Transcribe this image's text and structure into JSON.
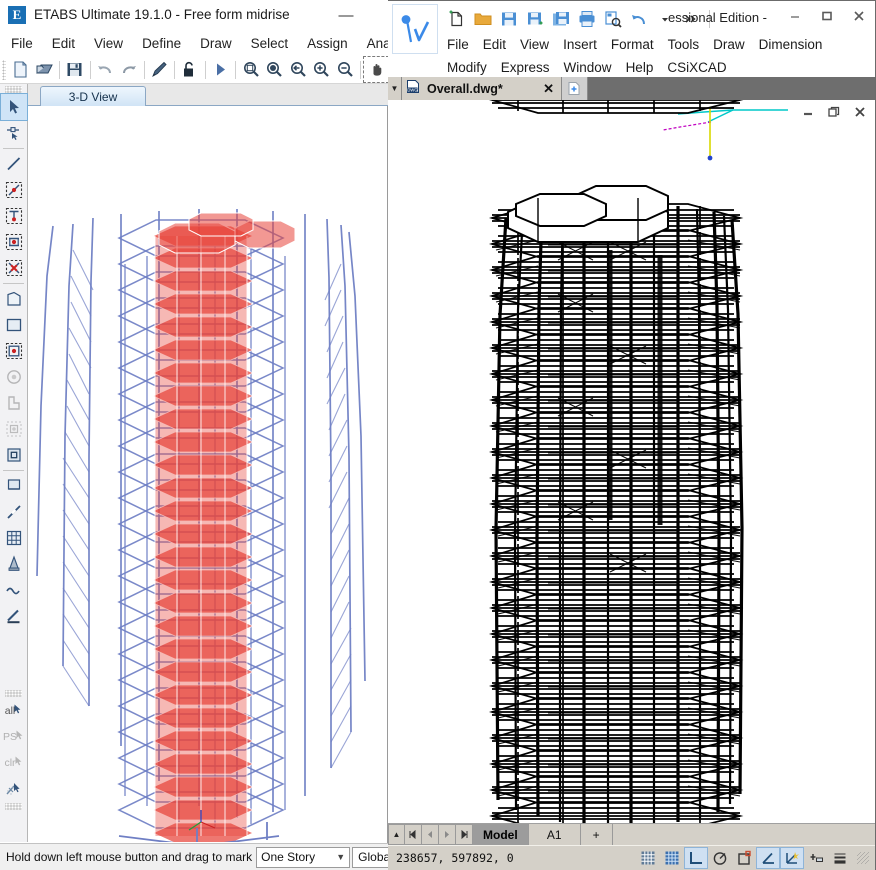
{
  "etabs": {
    "title": "ETABS Ultimate 19.1.0 - Free form midrise",
    "logo_letter": "E",
    "minimize_glyph": "—",
    "menus": [
      "File",
      "Edit",
      "View",
      "Define",
      "Draw",
      "Select",
      "Assign",
      "Analyze"
    ],
    "toolbar": [
      {
        "name": "new-model-icon",
        "tip": "New Model"
      },
      {
        "name": "open-model-icon",
        "tip": "Open Model"
      },
      {
        "name": "save-icon",
        "tip": "Save"
      },
      {
        "name": "undo-icon",
        "tip": "Undo"
      },
      {
        "name": "redo-icon",
        "tip": "Redo"
      },
      {
        "name": "edit-pen-icon",
        "tip": "Modify"
      },
      {
        "name": "unlock-icon",
        "tip": "Lock/Unlock Model"
      },
      {
        "name": "run-analysis-icon",
        "tip": "Run Analysis"
      },
      {
        "name": "zoom-window-icon",
        "tip": "Rubber Band Zoom"
      },
      {
        "name": "zoom-full-icon",
        "tip": "Restore Full View"
      },
      {
        "name": "zoom-previous-icon",
        "tip": "Previous Zoom"
      },
      {
        "name": "zoom-in-icon",
        "tip": "Zoom In One Step"
      },
      {
        "name": "zoom-out-icon",
        "tip": "Zoom Out One Step"
      },
      {
        "name": "pan-icon",
        "tip": "Pan"
      }
    ],
    "side_tools": [
      {
        "name": "select-arrow-icon",
        "selected": true
      },
      {
        "name": "select-poke-icon",
        "selected": false
      },
      {
        "name": "draw-line-icon",
        "selected": false
      },
      {
        "name": "select-line-objects-icon",
        "selected": false
      },
      {
        "name": "select-point-on-line-icon",
        "selected": false
      },
      {
        "name": "select-in-window-icon",
        "selected": false
      },
      {
        "name": "deselect-all-icon",
        "selected": false
      },
      {
        "name": "draw-quad-area-icon",
        "selected": false
      },
      {
        "name": "draw-rect-area-icon",
        "selected": false
      },
      {
        "name": "select-area-objects-icon",
        "selected": false
      },
      {
        "name": "select-circle-icon",
        "selected": false,
        "disabled": true
      },
      {
        "name": "select-wall-icon",
        "selected": false,
        "disabled": true
      },
      {
        "name": "select-floor-icon",
        "selected": false,
        "disabled": true
      },
      {
        "name": "select-frame-section-icon",
        "selected": false
      },
      {
        "name": "draw-developed-elevation-icon",
        "selected": false
      },
      {
        "name": "draw-diagonal-icon",
        "selected": false
      },
      {
        "name": "grid-icon",
        "selected": false
      },
      {
        "name": "set-view-icon",
        "selected": false
      },
      {
        "name": "wave-icon",
        "selected": false
      },
      {
        "name": "draw-section-cut-icon",
        "selected": false
      }
    ],
    "side_text_tools": [
      {
        "name": "select-all-button",
        "label": "all"
      },
      {
        "name": "select-previous-button",
        "label": "PS",
        "disabled": true
      },
      {
        "name": "clear-selection-button",
        "label": "clr",
        "disabled": true
      },
      {
        "name": "select-by-property-button",
        "label": ""
      }
    ],
    "view_tab": "3-D View",
    "statusbar": {
      "message": "Hold down left mouse button and drag to mark",
      "story_selector": "One Story",
      "coord_system": "Global"
    }
  },
  "cad": {
    "edition_text": "essional Edition -",
    "menus": [
      "File",
      "Edit",
      "View",
      "Insert",
      "Format",
      "Tools",
      "Draw",
      "Dimension",
      "Modify",
      "Express",
      "Window",
      "Help",
      "CSiXCAD"
    ],
    "quick_access": [
      {
        "name": "new-drawing-icon",
        "tip": "New"
      },
      {
        "name": "open-folder-icon",
        "tip": "Open"
      },
      {
        "name": "save-icon",
        "tip": "Save"
      },
      {
        "name": "save-as-icon",
        "tip": "Save As"
      },
      {
        "name": "save-all-icon",
        "tip": "Save All"
      },
      {
        "name": "print-icon",
        "tip": "Print"
      },
      {
        "name": "print-preview-icon",
        "tip": "Print Preview"
      },
      {
        "name": "undo-icon",
        "tip": "Undo"
      },
      {
        "name": "undo-dropdown-icon",
        "tip": "Undo History"
      },
      {
        "name": "more-commands-icon",
        "tip": "More"
      }
    ],
    "window_controls": [
      {
        "name": "minimize-button",
        "glyph": "—"
      },
      {
        "name": "maximize-button",
        "glyph": "☐"
      },
      {
        "name": "close-button",
        "glyph": "✕"
      }
    ],
    "document_tab": {
      "title": "Overall.dwg*",
      "file_icon": "dwg-file-icon",
      "close_glyph": "✕"
    },
    "tab_dropdown_glyph": "▼",
    "new_tab_glyph": "+",
    "child_window_controls": [
      {
        "name": "child-minimize-button",
        "glyph": "–"
      },
      {
        "name": "child-restore-button",
        "glyph": "❐"
      },
      {
        "name": "child-close-button",
        "glyph": "✕"
      }
    ],
    "model_tabs": {
      "nav": [
        {
          "name": "tab-scroll-up-button",
          "glyph": "▲"
        },
        {
          "name": "tab-first-button",
          "glyph": "⏮"
        },
        {
          "name": "tab-prev-button",
          "glyph": "◀"
        },
        {
          "name": "tab-next-button",
          "glyph": "▶"
        },
        {
          "name": "tab-last-button",
          "glyph": "⏭"
        }
      ],
      "tabs": [
        {
          "label": "Model",
          "active": true
        },
        {
          "label": "A1",
          "active": false
        }
      ],
      "add_label": "+"
    },
    "statusbar": {
      "coordinates": "238657, 597892, 0",
      "toggles": [
        {
          "name": "snap-grid-icon",
          "on": false
        },
        {
          "name": "display-grid-icon",
          "on": false
        },
        {
          "name": "ortho-mode-icon",
          "on": true
        },
        {
          "name": "polar-tracking-icon",
          "on": false
        },
        {
          "name": "object-snap-icon",
          "on": false
        },
        {
          "name": "object-snap-tracking-icon",
          "on": true
        },
        {
          "name": "dynamic-ucs-icon",
          "on": true
        },
        {
          "name": "dynamic-input-icon",
          "on": false
        },
        {
          "name": "lineweight-icon",
          "on": false
        }
      ]
    }
  },
  "colors": {
    "etabs_frame_blue": "#6f7fc4",
    "etabs_slab_red": "#e8443a",
    "etabs_accent": "#1a6fb4",
    "cad_line_black": "#000000",
    "cad_ucs_yellow": "#d8d800",
    "cad_ucs_cyan": "#00c8c8",
    "cad_ucs_magenta": "#c000c0",
    "cad_tab_gray": "#d4d0c8",
    "cad_tabbar_dark": "#6e6e6e"
  }
}
